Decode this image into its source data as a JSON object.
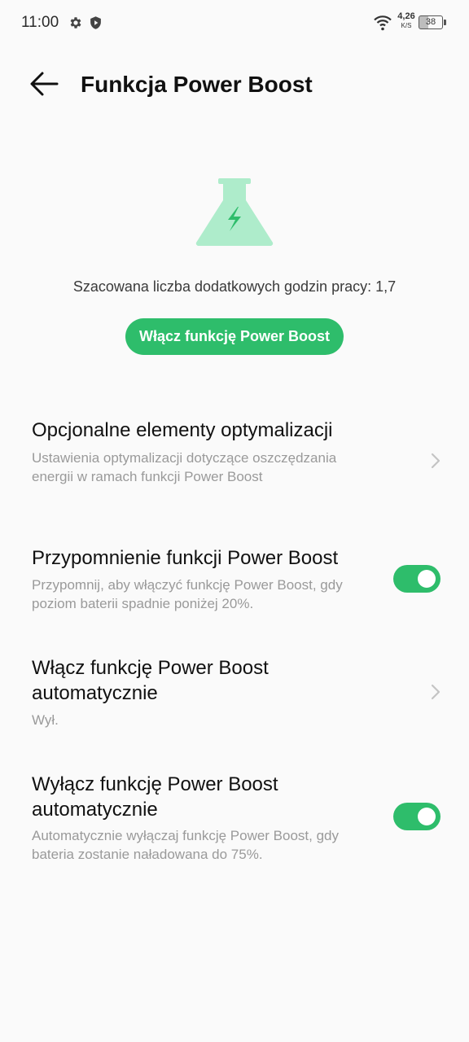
{
  "status_bar": {
    "time": "11:00",
    "net_speed_value": "4,26",
    "net_speed_unit": "K/S",
    "battery_level": "38",
    "icons": [
      "gear-icon",
      "shield-icon",
      "wifi-icon",
      "battery-icon"
    ]
  },
  "header": {
    "back_icon": "arrow-left-icon",
    "title": "Funkcja Power Boost"
  },
  "hero": {
    "icon": "flask-bolt-icon",
    "accent_color": "#2ebd6b",
    "icon_color": "#aeeccb",
    "estimate_text": "Szacowana liczba dodatkowych godzin pracy: 1,7",
    "enable_button": "Włącz funkcję Power Boost"
  },
  "settings": [
    {
      "title": "Opcjonalne elementy optymalizacji",
      "subtitle": "Ustawienia optymalizacji dotyczące oszczędzania energii w ramach funkcji Power Boost",
      "control": "chevron"
    },
    {
      "title": "Przypomnienie funkcji Power Boost",
      "subtitle": "Przypomnij, aby włączyć funkcję Power Boost, gdy poziom baterii spadnie poniżej 20%.",
      "control": "toggle",
      "enabled": true
    },
    {
      "title": "Włącz funkcję Power Boost automatycznie",
      "subtitle": "Wył.",
      "control": "chevron"
    },
    {
      "title": "Wyłącz funkcję Power Boost automatycznie",
      "subtitle": "Automatycznie wyłączaj funkcję Power Boost, gdy bateria zostanie naładowana do 75%.",
      "control": "toggle",
      "enabled": true
    }
  ]
}
